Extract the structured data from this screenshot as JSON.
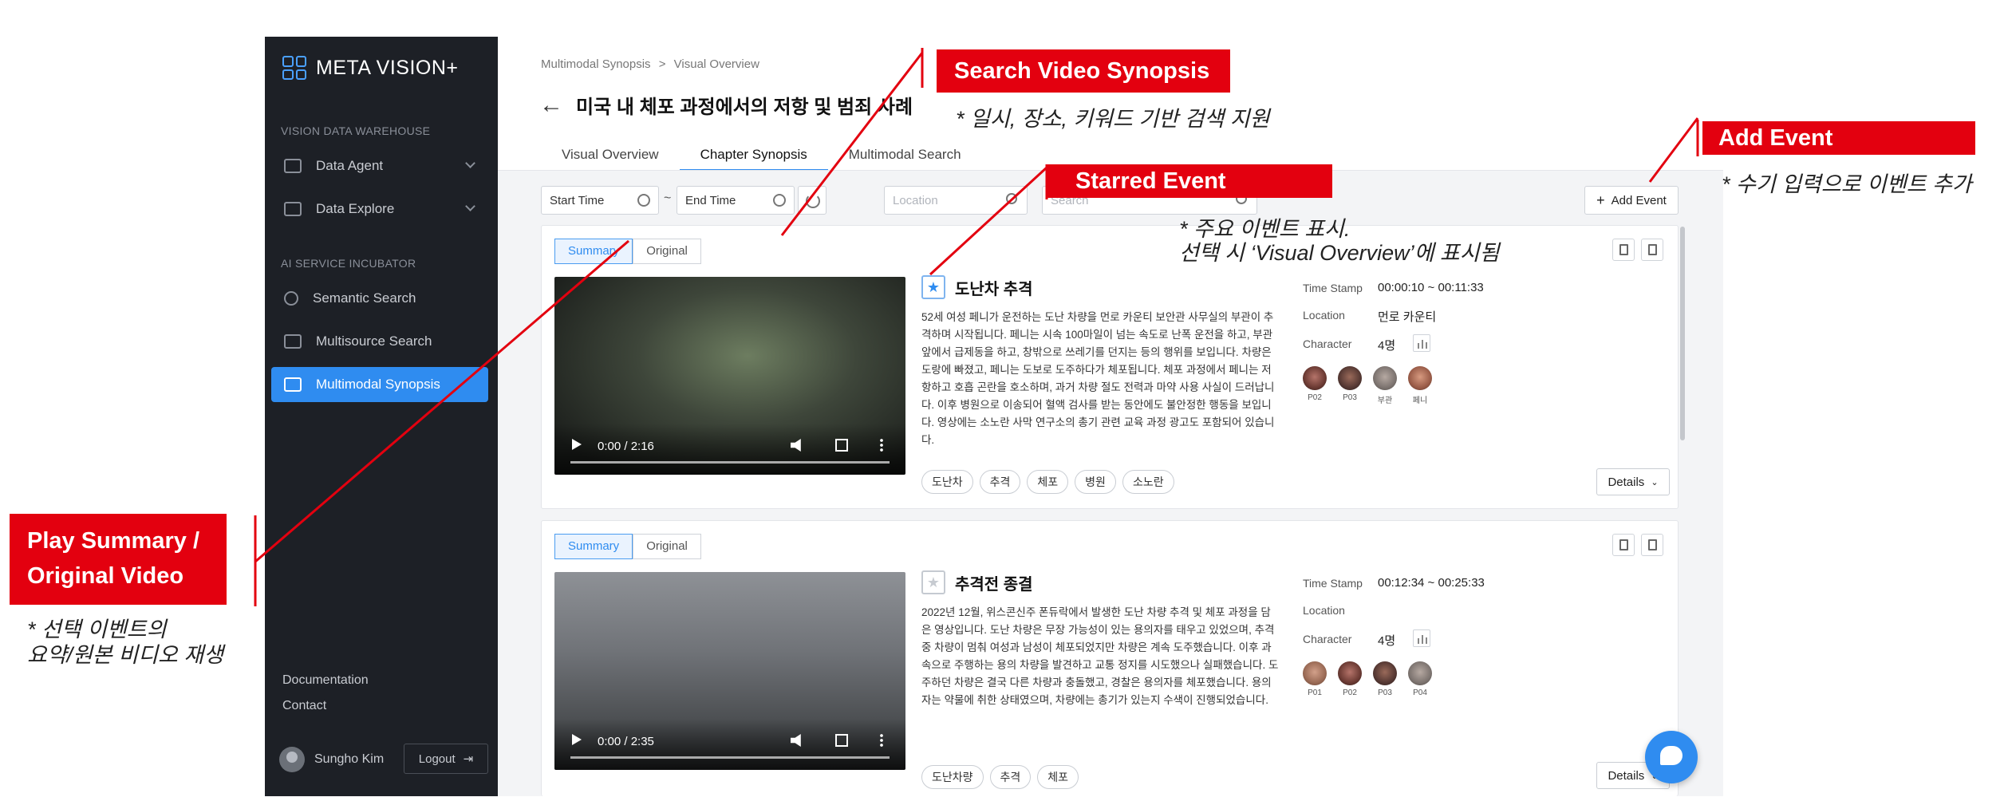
{
  "sidebar": {
    "logo": "META VISION+",
    "sections": [
      {
        "label": "VISION DATA WAREHOUSE"
      },
      {
        "label": "AI SERVICE INCUBATOR"
      }
    ],
    "items": [
      {
        "label": "Data Agent"
      },
      {
        "label": "Data Explore"
      },
      {
        "label": "Semantic Search"
      },
      {
        "label": "Multisource Search"
      },
      {
        "label": "Multimodal Synopsis"
      }
    ],
    "footer_links": [
      {
        "label": "Documentation"
      },
      {
        "label": "Contact"
      }
    ],
    "user_name": "Sungho Kim",
    "logout_label": "Logout"
  },
  "header": {
    "breadcrumb": [
      "Multimodal Synopsis",
      "Visual Overview"
    ],
    "breadcrumb_sep": ">",
    "title": "미국 내 체포 과정에서의 저항 및 범죄 사례",
    "tabs": [
      {
        "label": "Visual Overview"
      },
      {
        "label": "Chapter Synopsis"
      },
      {
        "label": "Multimodal Search"
      }
    ]
  },
  "filters": {
    "start_time": "Start Time",
    "end_time": "End Time",
    "tilde": "~",
    "location_placeholder": "Location",
    "search_placeholder": "Search",
    "add_event": "Add Event"
  },
  "segment": {
    "summary": "Summary",
    "original": "Original"
  },
  "meta_labels": {
    "time_stamp": "Time Stamp",
    "location": "Location",
    "character": "Character"
  },
  "details_label": "Details",
  "events": [
    {
      "starred": true,
      "title": "도난차 추격",
      "description": "52세 여성 페니가 운전하는 도난 차량을 먼로 카운티 보안관 사무실의 부관이 추격하며 시작됩니다. 페니는 시속 100마일이 넘는 속도로 난폭 운전을 하고, 부관 앞에서 급제동을 하고, 창밖으로 쓰레기를 던지는 등의 행위를 보입니다. 차량은 도랑에 빠졌고, 페니는 도보로 도주하다가 체포됩니다. 체포 과정에서 페니는 저항하고 호흡 곤란을 호소하며, 과거 차량 절도 전력과 마약 사용 사실이 드러납니다. 이후 병원으로 이송되어 혈액 검사를 받는 동안에도 불안정한 행동을 보입니다. 영상에는 소노란 사막 연구소의 총기 관련 교육 과정 광고도 포함되어 있습니다.",
      "video_time": "0:00 / 2:16",
      "time_stamp": "00:00:10 ~ 00:11:33",
      "location": "먼로 카운티",
      "character_count": "4명",
      "characters": [
        {
          "label": "P02"
        },
        {
          "label": "P03"
        },
        {
          "label": "부관"
        },
        {
          "label": "페니"
        }
      ],
      "tags": [
        {
          "label": "도난차"
        },
        {
          "label": "추격"
        },
        {
          "label": "체포"
        },
        {
          "label": "병원"
        },
        {
          "label": "소노란"
        }
      ]
    },
    {
      "starred": false,
      "title": "추격전 종결",
      "description": "2022년 12월, 위스콘신주 폰듀락에서 발생한 도난 차량 추격 및 체포 과정을 담은 영상입니다. 도난 차량은 무장 가능성이 있는 용의자를 태우고 있었으며, 추격 중 차량이 멈춰 여성과 남성이 체포되었지만 차량은 계속 도주했습니다. 이후 과속으로 주행하는 용의 차량을 발견하고 교통 정지를 시도했으나 실패했습니다. 도주하던 차량은 결국 다른 차량과 충돌했고, 경찰은 용의자를 체포했습니다. 용의자는 약물에 취한 상태였으며, 차량에는 총기가 있는지 수색이 진행되었습니다.",
      "video_time": "0:00 / 2:35",
      "time_stamp": "00:12:34 ~ 00:25:33",
      "location": "",
      "character_count": "4명",
      "characters": [
        {
          "label": "P01"
        },
        {
          "label": "P02"
        },
        {
          "label": "P03"
        },
        {
          "label": "P04"
        }
      ],
      "tags": [
        {
          "label": "도난차량"
        },
        {
          "label": "추격"
        },
        {
          "label": "체포"
        }
      ]
    }
  ],
  "annotations": {
    "search_title": "Search Video Synopsis",
    "search_note": "* 일시, 장소, 키워드 기반 검색 지원",
    "add_title": "Add Event",
    "add_note": "* 수기 입력으로 이벤트 추가",
    "star_title": "Starred Event",
    "star_note_1": "* 주요 이벤트 표시.",
    "star_note_2": "선택 시 ‘Visual Overview’에 표시됨",
    "play_title_1": "Play Summary /",
    "play_title_2": "Original Video",
    "play_note_1": "* 선택 이벤트의",
    "play_note_2": "요약/원본 비디오 재생"
  },
  "colors": {
    "accent": "#2f8cf0",
    "sidebar_bg": "#1d2026",
    "callout": "#e3000f"
  },
  "icons": [
    "logo-grid-icon",
    "dashboard-icon",
    "chart-icon",
    "search-icon",
    "image-icon",
    "windows-icon",
    "clock-icon",
    "refresh-icon",
    "plus-icon",
    "trash-icon",
    "export-icon",
    "star-icon",
    "bar-chart-icon",
    "chevron-down-icon",
    "logout-icon",
    "chat-bubble-icon"
  ]
}
